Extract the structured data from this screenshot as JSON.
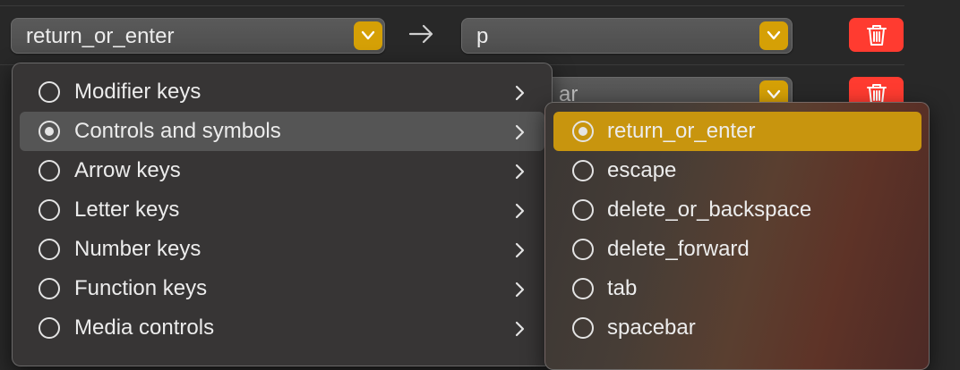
{
  "mapping_rows": [
    {
      "from_value": "return_or_enter",
      "to_value": "p"
    },
    {
      "to_value_partial": "ar"
    }
  ],
  "category_menu": {
    "items": [
      {
        "label": "Modifier keys",
        "selected": false
      },
      {
        "label": "Controls and symbols",
        "selected": true
      },
      {
        "label": "Arrow keys",
        "selected": false
      },
      {
        "label": "Letter keys",
        "selected": false
      },
      {
        "label": "Number keys",
        "selected": false
      },
      {
        "label": "Function keys",
        "selected": false
      },
      {
        "label": "Media controls",
        "selected": false
      }
    ]
  },
  "submenu": {
    "items": [
      {
        "label": "return_or_enter",
        "selected": true
      },
      {
        "label": "escape",
        "selected": false
      },
      {
        "label": "delete_or_backspace",
        "selected": false
      },
      {
        "label": "delete_forward",
        "selected": false
      },
      {
        "label": "tab",
        "selected": false
      },
      {
        "label": "spacebar",
        "selected": false
      }
    ]
  },
  "icons": {
    "arrow": "arrow-right-icon",
    "dropdown": "chevron-down-icon",
    "delete": "trash-icon",
    "submenu": "chevron-right-icon"
  },
  "colors": {
    "accent": "#d5a006",
    "selection": "#c8950e",
    "delete": "#ff3b30",
    "background": "#282828"
  }
}
